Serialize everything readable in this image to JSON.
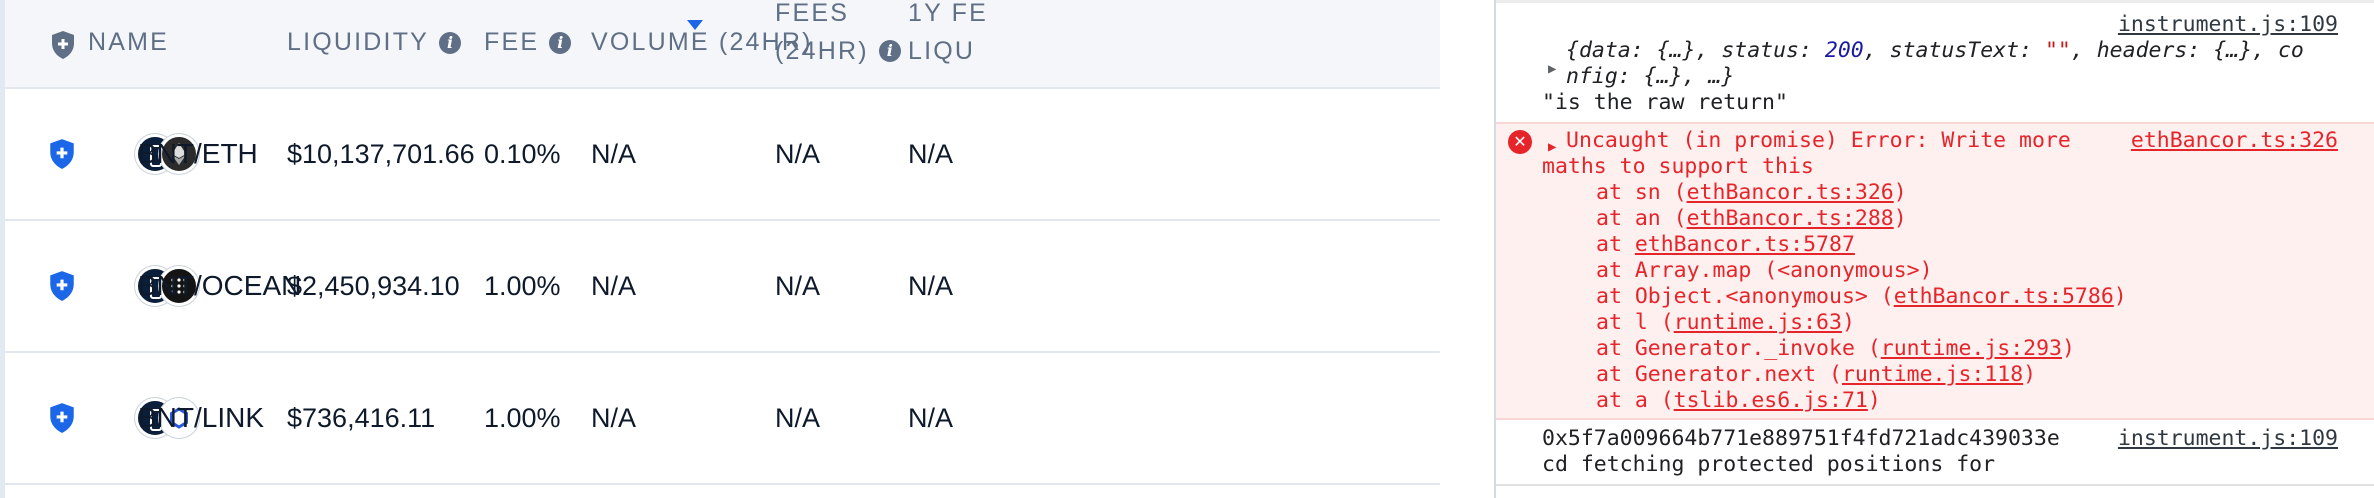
{
  "table": {
    "headers": {
      "name": "NAME",
      "liquidity": "LIQUIDITY",
      "fee": "FEE",
      "volume": "VOLUME (24HR)",
      "fees_line1": "FEES",
      "fees_line2": "(24HR)",
      "apr_line1": "1Y FE",
      "apr_line2": "LIQU"
    },
    "rows": [
      {
        "pair": "BNT/ETH",
        "liquidity": "$10,137,701.66",
        "fee": "0.10%",
        "volume": "N/A",
        "fees": "N/A",
        "apr": "N/A"
      },
      {
        "pair": "BNT/OCEAN",
        "liquidity": "$2,450,934.10",
        "fee": "1.00%",
        "volume": "N/A",
        "fees": "N/A",
        "apr": "N/A"
      },
      {
        "pair": "BNT/LINK",
        "liquidity": "$736,416.11",
        "fee": "1.00%",
        "volume": "N/A",
        "fees": "N/A",
        "apr": "N/A"
      }
    ],
    "accent_color": "#1c66e8"
  },
  "console": {
    "log1": {
      "source": "instrument.js:109",
      "obj_line1_pre": "{data: {…}, status: ",
      "status_value": "200",
      "obj_line1_mid": ", statusText: ",
      "status_text_value": "\"\"",
      "obj_line1_post": ", headers: {…}, co",
      "obj_line2": "nfig: {…}, …}",
      "note": "\"is the raw return\""
    },
    "error": {
      "line1": "Uncaught (in promise) Error: Write more",
      "line2": "maths to support this",
      "source": "ethBancor.ts:326",
      "stack": [
        {
          "prefix": "at sn (",
          "link": "ethBancor.ts:326",
          "suffix": ")"
        },
        {
          "prefix": "at an (",
          "link": "ethBancor.ts:288",
          "suffix": ")"
        },
        {
          "prefix": "at ",
          "link": "ethBancor.ts:5787",
          "suffix": ""
        },
        {
          "prefix": "at Array.map (<anonymous>)",
          "link": "",
          "suffix": ""
        },
        {
          "prefix": "at Object.<anonymous> (",
          "link": "ethBancor.ts:5786",
          "suffix": ")"
        },
        {
          "prefix": "at l (",
          "link": "runtime.js:63",
          "suffix": ")"
        },
        {
          "prefix": "at Generator._invoke (",
          "link": "runtime.js:293",
          "suffix": ")"
        },
        {
          "prefix": "at Generator.next (",
          "link": "runtime.js:118",
          "suffix": ")"
        },
        {
          "prefix": "at a (",
          "link": "tslib.es6.js:71",
          "suffix": ")"
        }
      ]
    },
    "log2": {
      "line1": "0x5f7a009664b771e889751f4fd721adc439033e",
      "line2": "cd fetching protected positions for",
      "source": "instrument.js:109"
    },
    "error_color": "#e6252b"
  }
}
